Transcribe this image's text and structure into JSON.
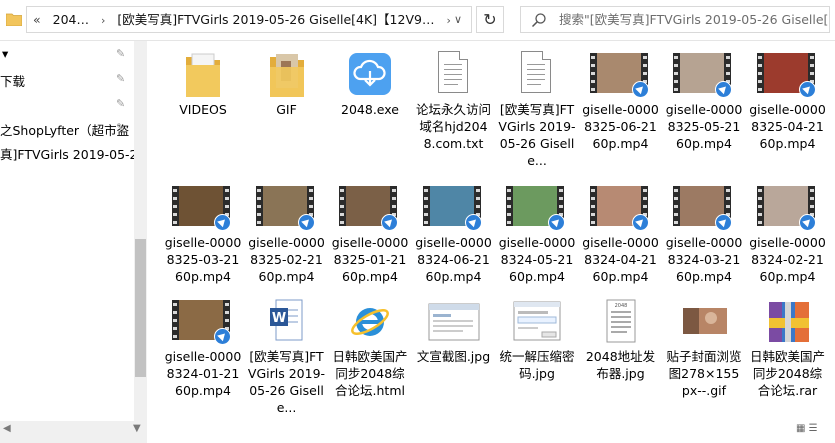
{
  "address_bar": {
    "breadcrumbs": [
      "204…",
      "[欧美写真]FTVGirls 2019-05-26 Giselle[4K]【12V9…"
    ],
    "overflow_glyph": "«",
    "dropdown_glyph": "∨"
  },
  "search": {
    "placeholder": "搜索\"[欧美写真]FTVGirls 2019-05-26 Giselle[..."
  },
  "nav": {
    "items": [
      {
        "label": "▾",
        "pinned": false
      },
      {
        "label": "下载",
        "pinned": true
      },
      {
        "label": "",
        "pinned": true
      },
      {
        "label": "之ShopLyfter（超市盗",
        "pinned": true
      },
      {
        "label": "真]FTVGirls 2019-05-26",
        "pinned": false
      }
    ]
  },
  "files": [
    {
      "name": "VIDEOS",
      "type": "folder"
    },
    {
      "name": "GIF",
      "type": "folder-gif"
    },
    {
      "name": "2048.exe",
      "type": "exe"
    },
    {
      "name": "论坛永久访问域名hjd2048.com.txt",
      "type": "txt"
    },
    {
      "name": "[欧美写真]FTVGirls 2019-05-26 Giselle...",
      "type": "txt"
    },
    {
      "name": "giselle-00008325-06-2160p.mp4",
      "type": "video",
      "tone": "#a9896e"
    },
    {
      "name": "giselle-00008325-05-2160p.mp4",
      "type": "video",
      "tone": "#b6a392"
    },
    {
      "name": "giselle-00008325-04-2160p.mp4",
      "type": "video",
      "tone": "#9c3b2d"
    },
    {
      "name": "giselle-00008325-03-2160p.mp4",
      "type": "video",
      "tone": "#6e5234"
    },
    {
      "name": "giselle-00008325-02-2160p.mp4",
      "type": "video",
      "tone": "#8a7456"
    },
    {
      "name": "giselle-00008325-01-2160p.mp4",
      "type": "video",
      "tone": "#7b6047"
    },
    {
      "name": "giselle-00008324-06-2160p.mp4",
      "type": "video",
      "tone": "#4f86a6"
    },
    {
      "name": "giselle-00008324-05-2160p.mp4",
      "type": "video",
      "tone": "#6c9a5f"
    },
    {
      "name": "giselle-00008324-04-2160p.mp4",
      "type": "video",
      "tone": "#b78a73"
    },
    {
      "name": "giselle-00008324-03-2160p.mp4",
      "type": "video",
      "tone": "#9c7a63"
    },
    {
      "name": "giselle-00008324-02-2160p.mp4",
      "type": "video",
      "tone": "#b9a79a"
    },
    {
      "name": "giselle-00008324-01-2160p.mp4",
      "type": "video",
      "tone": "#8b6a45"
    },
    {
      "name": "[欧美写真]FTVGirls 2019-05-26 Giselle...",
      "type": "word"
    },
    {
      "name": "日韩欧美国产同步2048综合论坛.html",
      "type": "ie"
    },
    {
      "name": "文宣截图.jpg",
      "type": "img-screen"
    },
    {
      "name": "统一解压缩密码.jpg",
      "type": "img-dialog"
    },
    {
      "name": "2048地址发布器.jpg",
      "type": "img-doc"
    },
    {
      "name": "贴子封面浏览图278×155px--.gif",
      "type": "img-photo"
    },
    {
      "name": "日韩欧美国产同步2048综合论坛.rar",
      "type": "rar"
    }
  ],
  "colors": {
    "folder": "#e8b84a",
    "exe_blue": "#4da1f0",
    "play_badge": "#2d7fd8",
    "scroll_thumb": "#c2c2c2"
  }
}
